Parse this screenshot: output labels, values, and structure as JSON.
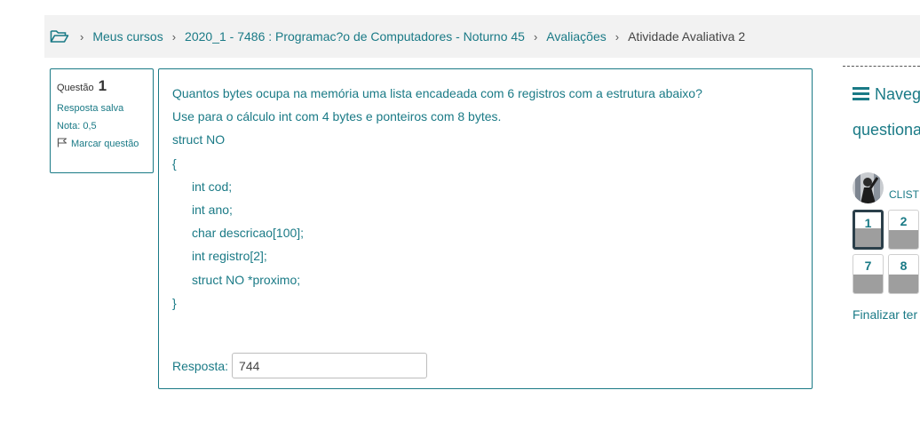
{
  "breadcrumb": {
    "items": [
      "Meus cursos",
      "2020_1 - 7486 : Programac?o de Computadores - Noturno 45",
      "Avaliações"
    ],
    "current": "Atividade Avaliativa 2",
    "separator": "›"
  },
  "question_info": {
    "label": "Questão",
    "number": "1",
    "state": "Resposta salva",
    "grade": "Nota: 0,5",
    "flag_label": "Marcar questão"
  },
  "question": {
    "lines": [
      "Quantos bytes ocupa na memória uma lista encadeada com 6 registros com a estrutura abaixo?",
      "Use para o cálculo int com 4 bytes e ponteiros com 8 bytes.",
      "struct NO",
      "{"
    ],
    "fields": [
      "int cod;",
      "int ano;",
      "char descricao[100];",
      "int registro[2];",
      "struct NO *proximo;"
    ],
    "close": "}",
    "answer_label": "Resposta:",
    "answer_value": "744"
  },
  "nav": {
    "title": "Naveg",
    "title2": "questiona",
    "user": "CLIST",
    "buttons": [
      "1",
      "2",
      "7",
      "8"
    ],
    "finish": "Finalizar ter"
  },
  "colors": {
    "accent": "#1a7a86",
    "current_border": "#2b3f4a",
    "answered_fill": "#9e9e9e"
  }
}
